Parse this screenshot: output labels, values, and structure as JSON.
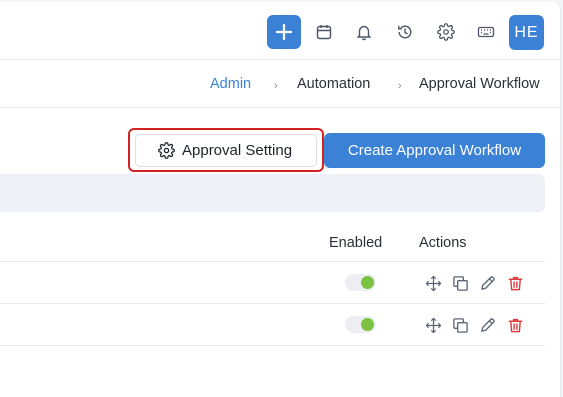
{
  "header": {
    "icons": [
      "plus-icon",
      "calendar-icon",
      "bell-icon",
      "history-icon",
      "gear-icon",
      "keyboard-icon"
    ],
    "avatar_initials": "HE"
  },
  "breadcrumb": {
    "items": [
      "Admin",
      "Automation",
      "Approval Workflow"
    ],
    "separator": "›"
  },
  "toolbar": {
    "approval_setting_label": "Approval Setting",
    "create_label": "Create Approval Workflow"
  },
  "table": {
    "columns": [
      "Enabled",
      "Actions"
    ],
    "rows": [
      {
        "enabled": true,
        "actions": [
          "move-icon",
          "copy-icon",
          "edit-icon",
          "delete-icon"
        ]
      },
      {
        "enabled": true,
        "actions": [
          "move-icon",
          "copy-icon",
          "edit-icon",
          "delete-icon"
        ]
      }
    ]
  },
  "colors": {
    "accent": "#3b82d6",
    "toggle_on": "#7cc241",
    "delete": "#e03b3b",
    "highlight": "#d32222"
  }
}
